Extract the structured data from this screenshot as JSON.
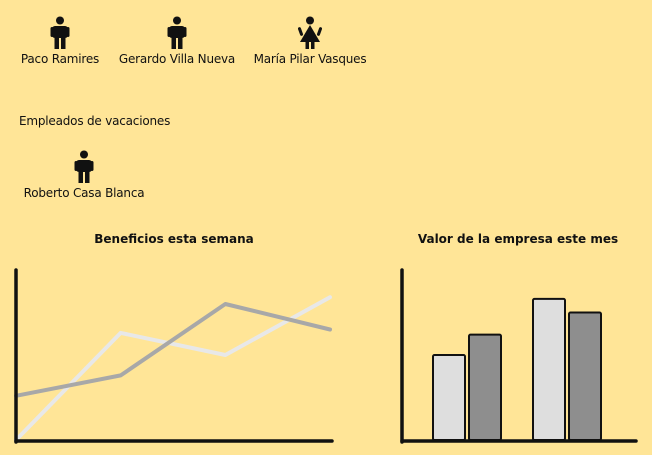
{
  "colors": {
    "background": "#ffe597",
    "icon": "#111111",
    "series_light": "#e8e8e8",
    "series_dark": "#a8a8a8",
    "bar_light": "#dedede",
    "bar_dark": "#8e8e8e"
  },
  "employees": [
    {
      "name": "Paco Ramires",
      "gender": "male",
      "icon": "male-person-icon"
    },
    {
      "name": "Gerardo Villa Nueva",
      "gender": "male",
      "icon": "male-person-icon"
    },
    {
      "name": "María Pilar Vasques",
      "gender": "female",
      "icon": "female-person-icon"
    }
  ],
  "vacation": {
    "heading": "Empleados de vacaciones",
    "employees": [
      {
        "name": "Roberto Casa Blanca",
        "gender": "male",
        "icon": "male-person-icon"
      }
    ]
  },
  "chart_data": [
    {
      "type": "line",
      "title": "Beneficios esta semana",
      "xlabel": "",
      "ylabel": "",
      "x": [
        0,
        1,
        2,
        3
      ],
      "ylim": [
        0,
        10
      ],
      "grid": false,
      "series": [
        {
          "values": [
            0,
            6.3,
            5.0,
            8.4
          ],
          "color": "#e8e8e8"
        },
        {
          "values": [
            2.6,
            3.8,
            8.0,
            6.5
          ],
          "color": "#a8a8a8"
        }
      ]
    },
    {
      "type": "bar",
      "title": "Valor de la empresa este mes",
      "xlabel": "",
      "ylabel": "",
      "categories": [
        "",
        ""
      ],
      "ylim": [
        0,
        10
      ],
      "grid": false,
      "series": [
        {
          "values": [
            5.0,
            8.3
          ],
          "color": "#dedede"
        },
        {
          "values": [
            6.2,
            7.5
          ],
          "color": "#8e8e8e"
        }
      ]
    }
  ]
}
